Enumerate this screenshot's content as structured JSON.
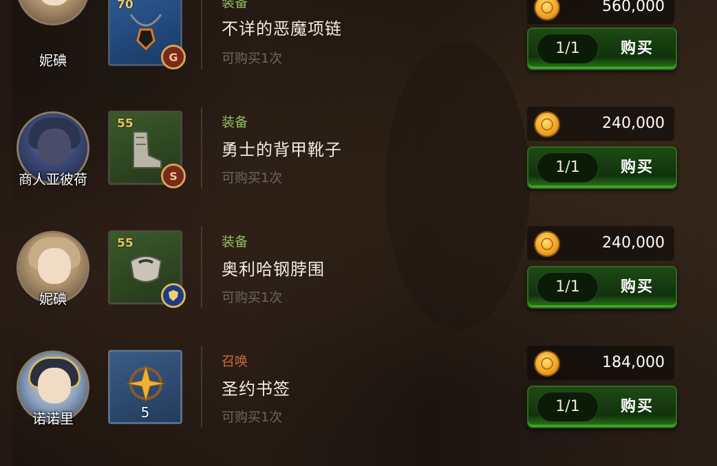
{
  "shop": {
    "items": [
      {
        "npc_name": "妮碘",
        "level": "70",
        "quantity": "",
        "grade_symbol": "G",
        "category": "装备",
        "name": "不详的恶魔项链",
        "limit": "可购买1次",
        "price": "560,000",
        "stock": "1/1",
        "buy_label": "购买"
      },
      {
        "npc_name": "商人亚彼荷",
        "level": "55",
        "quantity": "",
        "grade_symbol": "S",
        "category": "装备",
        "name": "勇士的背甲靴子",
        "limit": "可购买1次",
        "price": "240,000",
        "stock": "1/1",
        "buy_label": "购买"
      },
      {
        "npc_name": "妮碘",
        "level": "55",
        "quantity": "",
        "grade_symbol": "",
        "category": "装备",
        "name": "奥利哈钢脖围",
        "limit": "可购买1次",
        "price": "240,000",
        "stock": "1/1",
        "buy_label": "购买"
      },
      {
        "npc_name": "诺诺里",
        "level": "",
        "quantity": "5",
        "grade_symbol": "",
        "category": "召唤",
        "name": "圣约书签",
        "limit": "可购买1次",
        "price": "184,000",
        "stock": "1/1",
        "buy_label": "购买"
      }
    ]
  },
  "colors": {
    "equip_category": "#8fc060",
    "summon_category": "#d06a40",
    "buy_button": "#1e4a14",
    "coin": "#f0a020"
  }
}
